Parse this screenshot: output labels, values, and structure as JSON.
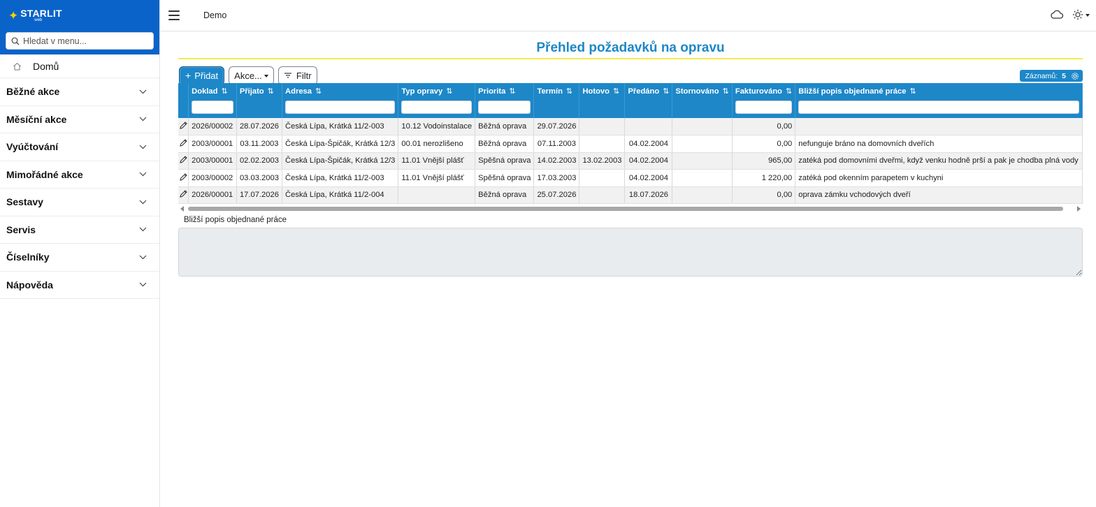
{
  "brand": {
    "name": "STARLIT",
    "sub": "web"
  },
  "sidebar": {
    "search_placeholder": "Hledat v menu...",
    "home_label": "Domů",
    "sections": [
      {
        "label": "Běžné akce",
        "name": "bezne-akce"
      },
      {
        "label": "Měsíční akce",
        "name": "mesicni-akce"
      },
      {
        "label": "Vyúčtování",
        "name": "vyuctovani"
      },
      {
        "label": "Mimořádné akce",
        "name": "mimoradne-akce"
      },
      {
        "label": "Sestavy",
        "name": "sestavy"
      },
      {
        "label": "Servis",
        "name": "servis"
      },
      {
        "label": "Číselníky",
        "name": "ciselniky"
      },
      {
        "label": "Nápověda",
        "name": "napoveda"
      }
    ]
  },
  "topbar": {
    "app_name": "Demo",
    "icons": [
      "menu-icon",
      "cloud-icon",
      "sun-icon"
    ]
  },
  "page": {
    "title": "Přehled požadavků na opravu"
  },
  "toolbar": {
    "add_label": "Přidat",
    "actions_label": "Akce...",
    "filter_label": "Filtr",
    "records_label": "Záznamů:",
    "records_count": "5"
  },
  "grid": {
    "columns": [
      {
        "label": "Doklad",
        "sortable": true
      },
      {
        "label": "Přijato",
        "sortable": true
      },
      {
        "label": "Adresa",
        "sortable": true
      },
      {
        "label": "Typ opravy",
        "sortable": true
      },
      {
        "label": "Priorita",
        "sortable": true
      },
      {
        "label": "Termín",
        "sortable": true
      },
      {
        "label": "Hotovo",
        "sortable": true
      },
      {
        "label": "Předáno",
        "sortable": true
      },
      {
        "label": "Stornováno",
        "sortable": true
      },
      {
        "label": "Fakturováno",
        "sortable": true
      },
      {
        "label": "Bližší popis objednané práce",
        "sortable": true
      }
    ],
    "filter_columns": [
      true,
      false,
      true,
      true,
      true,
      false,
      false,
      false,
      false,
      true,
      true
    ],
    "rows": [
      [
        "2026/00002",
        "28.07.2026",
        "Česká Lípa, Krátká 11/2-003",
        "10.12 Vodoinstalace",
        "Běžná oprava",
        "29.07.2026",
        "",
        "",
        "",
        "0,00",
        ""
      ],
      [
        "2003/00001",
        "03.11.2003",
        "Česká Lípa-Špičák, Krátká 12/3",
        "00.01 nerozlišeno",
        "Běžná oprava",
        "07.11.2003",
        "",
        "04.02.2004",
        "",
        "0,00",
        "nefunguje bráno na domovních dveřích"
      ],
      [
        "2003/00001",
        "02.02.2003",
        "Česká Lípa-Špičák, Krátká 12/3",
        "11.01 Vnější plášť",
        "Spěšná oprava",
        "14.02.2003",
        "13.02.2003",
        "04.02.2004",
        "",
        "965,00",
        "zatéká pod domovními dveřmi, když venku hodně prší a pak je chodba plná vody"
      ],
      [
        "2003/00002",
        "03.03.2003",
        "Česká Lípa, Krátká 11/2-003",
        "11.01 Vnější plášť",
        "Spěšná oprava",
        "17.03.2003",
        "",
        "04.02.2004",
        "",
        "1 220,00",
        "zatéká pod okenním parapetem v kuchyni"
      ],
      [
        "2026/00001",
        "17.07.2026",
        "Česká Lípa, Krátká 11/2-004",
        "",
        "Běžná oprava",
        "25.07.2026",
        "",
        "18.07.2026",
        "",
        "0,00",
        "oprava zámku vchodových dveří"
      ]
    ]
  },
  "detail": {
    "label": "Bližší popis objednané práce",
    "value": ""
  },
  "colors": {
    "brand": "#0a63c9",
    "accent": "#1d87c8",
    "title_underline": "#f4ea4d",
    "logo_star": "#f5d000"
  }
}
